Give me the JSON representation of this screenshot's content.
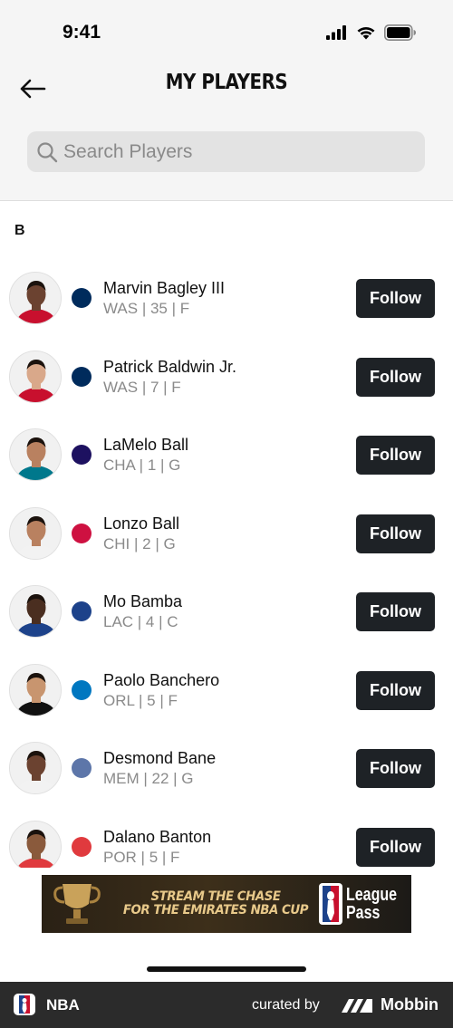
{
  "status_bar": {
    "time": "9:41"
  },
  "header": {
    "title": "MY PLAYERS",
    "back_icon": "arrow-left-icon"
  },
  "search": {
    "placeholder": "Search Players",
    "value": "",
    "icon": "search-icon"
  },
  "section": {
    "letter": "B"
  },
  "players": [
    {
      "name": "Marvin Bagley III",
      "meta": "WAS | 35 | F",
      "team": "WAS",
      "jersey_color": "#c8102e",
      "skin": "#6b4230",
      "logo_color": "#002b5c",
      "follow_label": "Follow"
    },
    {
      "name": "Patrick Baldwin Jr.",
      "meta": "WAS | 7 | F",
      "team": "WAS",
      "jersey_color": "#c8102e",
      "skin": "#d9a88a",
      "logo_color": "#002b5c",
      "follow_label": "Follow"
    },
    {
      "name": "LaMelo Ball",
      "meta": "CHA | 1 | G",
      "team": "CHA",
      "jersey_color": "#00788c",
      "skin": "#b98160",
      "logo_color": "#1d1160",
      "follow_label": "Follow"
    },
    {
      "name": "Lonzo Ball",
      "meta": "CHI | 2 | G",
      "team": "CHI",
      "jersey_color": "#f2f2f2",
      "skin": "#b98160",
      "logo_color": "#ce1141",
      "follow_label": "Follow"
    },
    {
      "name": "Mo Bamba",
      "meta": "LAC | 4 | C",
      "team": "LAC",
      "jersey_color": "#1d428a",
      "skin": "#4a2e20",
      "logo_color": "#1d428a",
      "follow_label": "Follow"
    },
    {
      "name": "Paolo Banchero",
      "meta": "ORL | 5 | F",
      "team": "ORL",
      "jersey_color": "#111111",
      "skin": "#c8956f",
      "logo_color": "#0077c0",
      "follow_label": "Follow"
    },
    {
      "name": "Desmond Bane",
      "meta": "MEM | 22 | G",
      "team": "MEM",
      "jersey_color": "#f2f2f2",
      "skin": "#6b4230",
      "logo_color": "#5d76a9",
      "follow_label": "Follow"
    },
    {
      "name": "Dalano Banton",
      "meta": "POR | 5 | F",
      "team": "POR",
      "jersey_color": "#e03a3e",
      "skin": "#8a5a3c",
      "logo_color": "#e03a3e",
      "follow_label": "Follow"
    }
  ],
  "ad": {
    "line1": "STREAM THE CHASE",
    "line2": "FOR THE EMIRATES NBA CUP",
    "brand_line1": "League",
    "brand_line2": "Pass",
    "icon": "trophy-icon"
  },
  "footer": {
    "app_name": "NBA",
    "curated_by": "curated by",
    "brand": "Mobbin"
  }
}
